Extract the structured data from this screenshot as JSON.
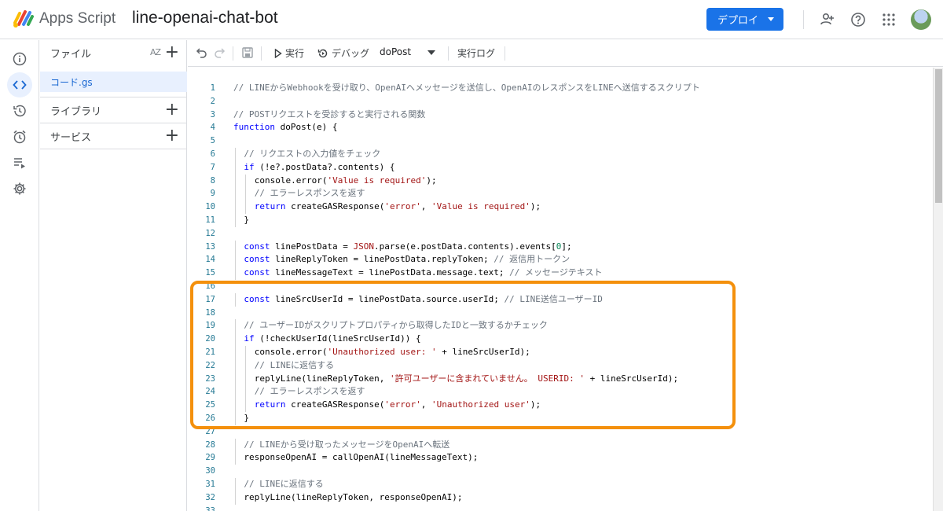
{
  "header": {
    "app_name": "Apps Script",
    "project_name": "line-openai-chat-bot",
    "deploy_label": "デプロイ"
  },
  "files_panel": {
    "files_label": "ファイル",
    "sort_label": "AZ",
    "active_file": "コード.gs",
    "libraries_label": "ライブラリ",
    "services_label": "サービス"
  },
  "toolbar": {
    "run_label": "実行",
    "debug_label": "デバッグ",
    "function_name": "doPost",
    "log_label": "実行ログ"
  },
  "editor": {
    "lines": [
      {
        "n": "1",
        "indent": 0,
        "tokens": [
          [
            "cm",
            "// LINEからWebhookを受け取り、OpenAIへメッセージを送信し、OpenAIのレスポンスをLINEへ送信するスクリプト"
          ]
        ]
      },
      {
        "n": "2",
        "indent": 0,
        "tokens": []
      },
      {
        "n": "3",
        "indent": 0,
        "tokens": [
          [
            "cm",
            "// POSTリクエストを受診すると実行される関数"
          ]
        ]
      },
      {
        "n": "4",
        "indent": 0,
        "tokens": [
          [
            "kw",
            "function "
          ],
          [
            "",
            "doPost(e) {"
          ]
        ]
      },
      {
        "n": "5",
        "indent": 0,
        "tokens": []
      },
      {
        "n": "6",
        "indent": 1,
        "tokens": [
          [
            "cm",
            "// リクエストの入力値をチェック"
          ]
        ]
      },
      {
        "n": "7",
        "indent": 1,
        "tokens": [
          [
            "kw",
            "if "
          ],
          [
            "",
            "(!e?.postData?.contents) {"
          ]
        ]
      },
      {
        "n": "8",
        "indent": 2,
        "tokens": [
          [
            "",
            "console.error("
          ],
          [
            "str",
            "'Value is required'"
          ],
          [
            "",
            ");"
          ]
        ]
      },
      {
        "n": "9",
        "indent": 2,
        "tokens": [
          [
            "cm",
            "// エラーレスポンスを返す"
          ]
        ]
      },
      {
        "n": "10",
        "indent": 2,
        "tokens": [
          [
            "kw",
            "return "
          ],
          [
            "",
            "createGASResponse("
          ],
          [
            "str",
            "'error'"
          ],
          [
            "",
            ", "
          ],
          [
            "str",
            "'Value is required'"
          ],
          [
            "",
            ");"
          ]
        ]
      },
      {
        "n": "11",
        "indent": 1,
        "tokens": [
          [
            "",
            "}"
          ]
        ]
      },
      {
        "n": "12",
        "indent": 0,
        "tokens": []
      },
      {
        "n": "13",
        "indent": 1,
        "tokens": [
          [
            "kw",
            "const "
          ],
          [
            "",
            "linePostData = "
          ],
          [
            "str",
            "JSON"
          ],
          [
            "",
            ".parse(e.postData.contents).events["
          ],
          [
            "num",
            "0"
          ],
          [
            "",
            "];"
          ]
        ]
      },
      {
        "n": "14",
        "indent": 1,
        "tokens": [
          [
            "kw",
            "const "
          ],
          [
            "",
            "lineReplyToken = linePostData.replyToken; "
          ],
          [
            "cm",
            "// 返信用トークン"
          ]
        ]
      },
      {
        "n": "15",
        "indent": 1,
        "tokens": [
          [
            "kw",
            "const "
          ],
          [
            "",
            "lineMessageText = linePostData.message.text; "
          ],
          [
            "cm",
            "// メッセージテキスト"
          ]
        ]
      },
      {
        "n": "16",
        "indent": 0,
        "tokens": []
      },
      {
        "n": "17",
        "indent": 1,
        "tokens": [
          [
            "kw",
            "const "
          ],
          [
            "",
            "lineSrcUserId = linePostData.source.userId; "
          ],
          [
            "cm",
            "// LINE送信ユーザーID"
          ]
        ]
      },
      {
        "n": "18",
        "indent": 0,
        "tokens": []
      },
      {
        "n": "19",
        "indent": 1,
        "tokens": [
          [
            "cm",
            "// ユーザーIDがスクリプトプロパティから取得したIDと一致するかチェック"
          ]
        ]
      },
      {
        "n": "20",
        "indent": 1,
        "tokens": [
          [
            "kw",
            "if "
          ],
          [
            "",
            "(!checkUserId(lineSrcUserId)) {"
          ]
        ]
      },
      {
        "n": "21",
        "indent": 2,
        "tokens": [
          [
            "",
            "console.error("
          ],
          [
            "str",
            "'Unauthorized user: '"
          ],
          [
            "",
            " + lineSrcUserId);"
          ]
        ]
      },
      {
        "n": "22",
        "indent": 2,
        "tokens": [
          [
            "cm",
            "// LINEに返信する"
          ]
        ]
      },
      {
        "n": "23",
        "indent": 2,
        "tokens": [
          [
            "",
            "replyLine(lineReplyToken, "
          ],
          [
            "str",
            "'許可ユーザーに含まれていません。 USERID: '"
          ],
          [
            "",
            " + lineSrcUserId);"
          ]
        ]
      },
      {
        "n": "24",
        "indent": 2,
        "tokens": [
          [
            "cm",
            "// エラーレスポンスを返す"
          ]
        ]
      },
      {
        "n": "25",
        "indent": 2,
        "tokens": [
          [
            "kw",
            "return "
          ],
          [
            "",
            "createGASResponse("
          ],
          [
            "str",
            "'error'"
          ],
          [
            "",
            ", "
          ],
          [
            "str",
            "'Unauthorized user'"
          ],
          [
            "",
            ");"
          ]
        ]
      },
      {
        "n": "26",
        "indent": 1,
        "tokens": [
          [
            "",
            "}"
          ]
        ]
      },
      {
        "n": "27",
        "indent": 0,
        "tokens": []
      },
      {
        "n": "28",
        "indent": 1,
        "tokens": [
          [
            "cm",
            "// LINEから受け取ったメッセージをOpenAIへ転送"
          ]
        ]
      },
      {
        "n": "29",
        "indent": 1,
        "tokens": [
          [
            "",
            "responseOpenAI = callOpenAI(lineMessageText);"
          ]
        ]
      },
      {
        "n": "30",
        "indent": 0,
        "tokens": []
      },
      {
        "n": "31",
        "indent": 1,
        "tokens": [
          [
            "cm",
            "// LINEに返信する"
          ]
        ]
      },
      {
        "n": "32",
        "indent": 1,
        "tokens": [
          [
            "",
            "replyLine(lineReplyToken, responseOpenAI);"
          ]
        ]
      },
      {
        "n": "33",
        "indent": 0,
        "tokens": []
      }
    ]
  },
  "colors": {
    "accent": "#1a73e8",
    "highlight_border": "#f4900c",
    "active_file_bg": "#e8f0fe"
  },
  "icons": {
    "rail": [
      "info-icon",
      "code-icon",
      "history-icon",
      "trigger-clock-icon",
      "executions-icon",
      "settings-gear-icon"
    ],
    "top_right": [
      "add-person-icon",
      "help-icon",
      "apps-grid-icon",
      "avatar"
    ]
  }
}
